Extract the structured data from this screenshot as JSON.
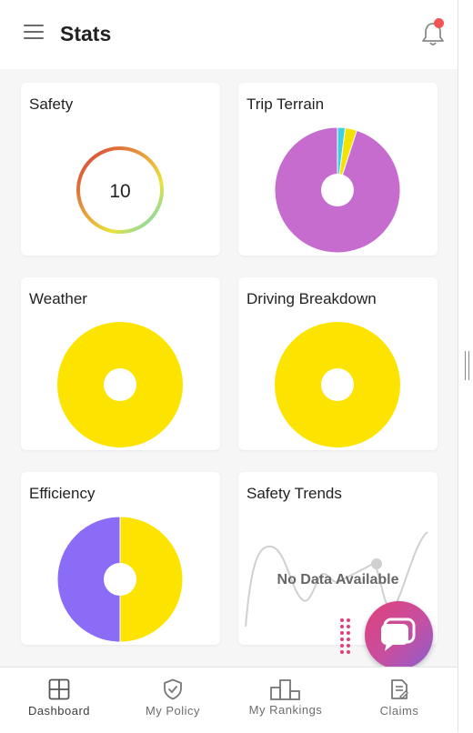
{
  "header": {
    "title": "Stats",
    "menu_icon": "hamburger-menu-icon",
    "notification_icon": "bell-icon",
    "notification_dot_color": "#f25454"
  },
  "cards": {
    "safety": {
      "title": "Safety",
      "score": "10"
    },
    "trip_terrain": {
      "title": "Trip Terrain"
    },
    "weather": {
      "title": "Weather"
    },
    "driving_breakdown": {
      "title": "Driving Breakdown"
    },
    "efficiency": {
      "title": "Efficiency"
    },
    "safety_trends": {
      "title": "Safety Trends",
      "empty_message": "No Data Available"
    }
  },
  "chart_data": [
    {
      "type": "pie",
      "chart": "trip_terrain",
      "values": [
        2,
        3,
        95
      ],
      "colors": [
        "#3ecfe0",
        "#f5e200",
        "#c66ccf"
      ]
    },
    {
      "type": "pie",
      "chart": "weather",
      "values": [
        100
      ],
      "colors": [
        "#fde400"
      ]
    },
    {
      "type": "pie",
      "chart": "driving_breakdown",
      "values": [
        100
      ],
      "colors": [
        "#fde400"
      ]
    },
    {
      "type": "pie",
      "chart": "efficiency",
      "values": [
        50,
        50
      ],
      "colors": [
        "#fde400",
        "#8a6cf7"
      ]
    }
  ],
  "tabs": [
    {
      "label": "Dashboard",
      "icon": "dashboard-icon",
      "active": true
    },
    {
      "label": "My Policy",
      "icon": "shield-check-icon",
      "active": false
    },
    {
      "label": "My Rankings",
      "icon": "rankings-podium-icon",
      "active": false
    },
    {
      "label": "Claims",
      "icon": "claims-document-icon",
      "active": false
    }
  ],
  "fab": {
    "icon": "chat-bubble-icon"
  }
}
